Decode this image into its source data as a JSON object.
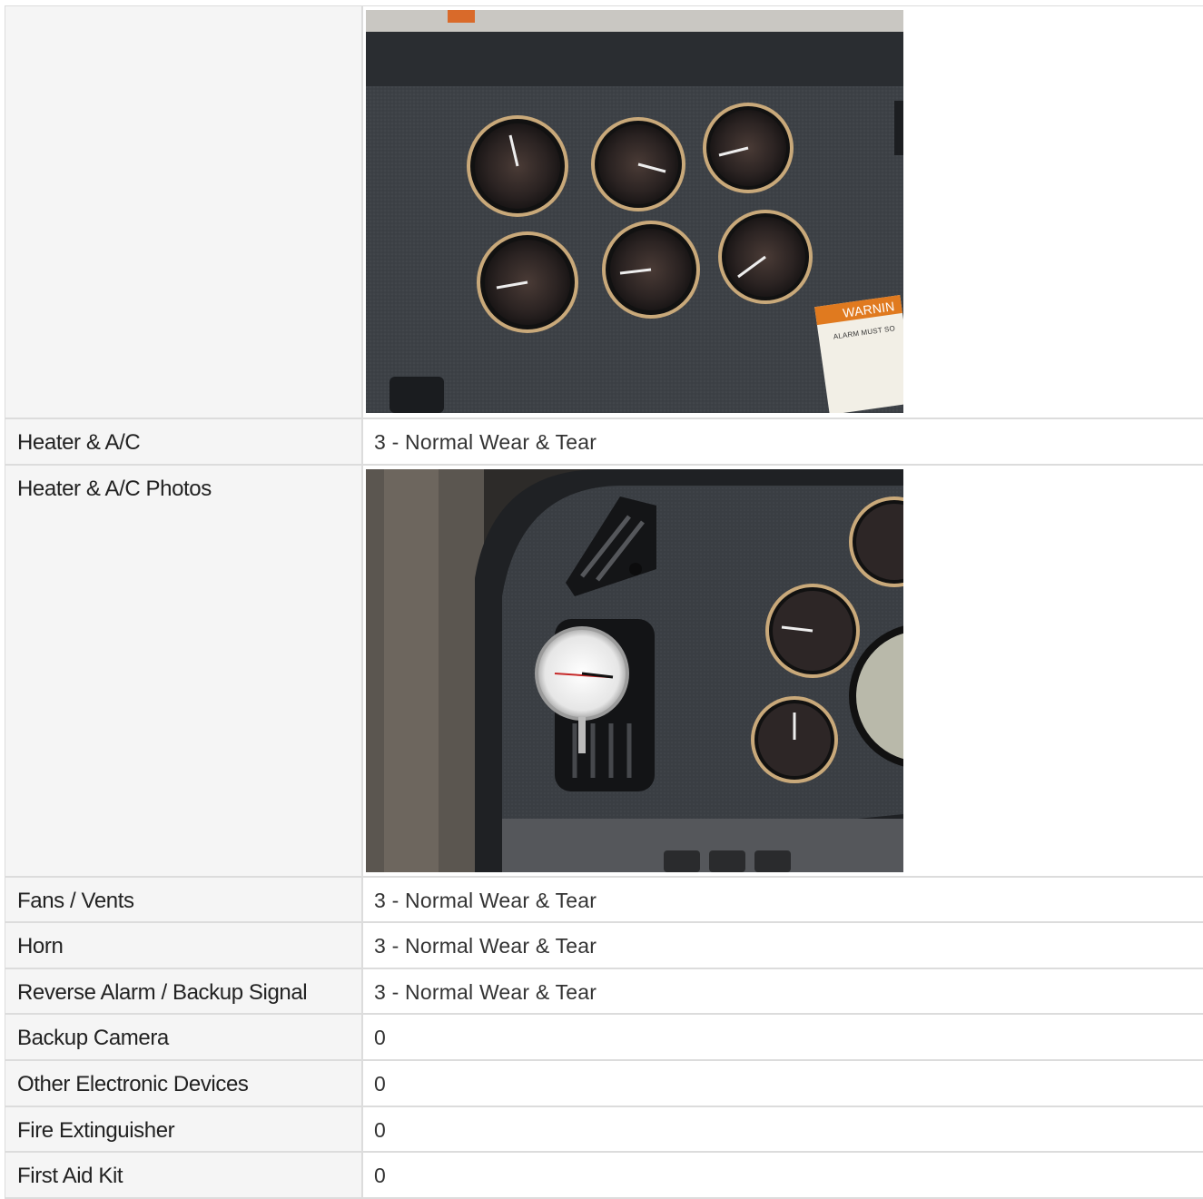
{
  "rows": [
    {
      "label": "",
      "value": "",
      "photo": "gauge-panel"
    },
    {
      "label": "Heater & A/C",
      "value": "3 - Normal Wear & Tear"
    },
    {
      "label": "Heater & A/C Photos",
      "value": "",
      "photo": "vent-thermometer"
    },
    {
      "label": "Fans / Vents",
      "value": "3 - Normal Wear & Tear"
    },
    {
      "label": "Horn",
      "value": "3 - Normal Wear & Tear"
    },
    {
      "label": "Reverse Alarm / Backup Signal",
      "value": "3 - Normal Wear & Tear"
    },
    {
      "label": "Backup Camera",
      "value": "0"
    },
    {
      "label": "Other Electronic Devices",
      "value": "0"
    },
    {
      "label": "Fire Extinguisher",
      "value": "0"
    },
    {
      "label": "First Aid Kit",
      "value": "0"
    }
  ],
  "photo1": {
    "warning_text": "WARNIN",
    "warning_sub": "ALARM MUST SO"
  },
  "colors": {
    "label_bg": "#f5f5f5",
    "border": "#dcdcdc",
    "dash": "#3f4348"
  }
}
